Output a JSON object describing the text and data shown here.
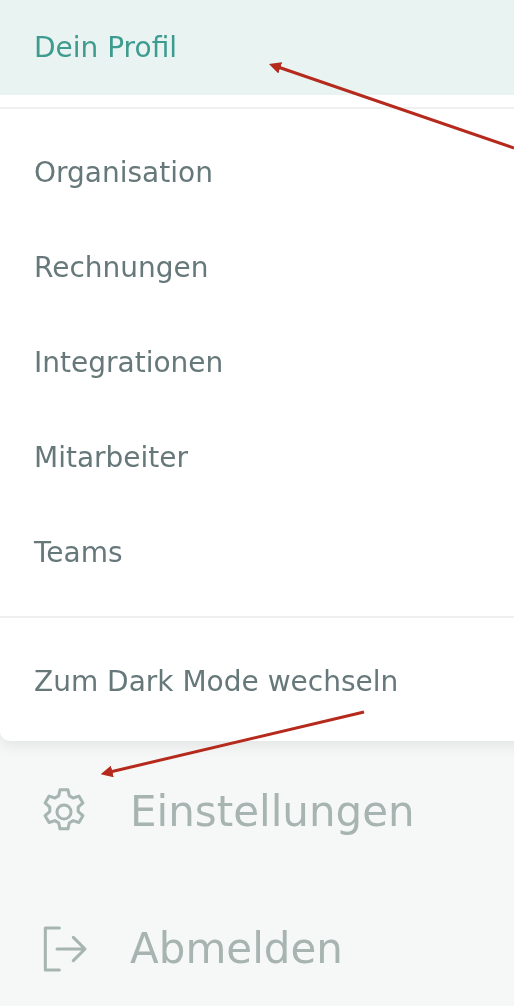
{
  "menu": {
    "sections": [
      [
        {
          "label": "Dein Profil",
          "selected": true
        }
      ],
      [
        {
          "label": "Organisation",
          "selected": false
        },
        {
          "label": "Rechnungen",
          "selected": false
        },
        {
          "label": "Integrationen",
          "selected": false
        },
        {
          "label": "Mitarbeiter",
          "selected": false
        },
        {
          "label": "Teams",
          "selected": false
        }
      ],
      [
        {
          "label": "Zum Dark Mode wechseln",
          "selected": false
        }
      ]
    ]
  },
  "sidebar": {
    "items": [
      {
        "kind": "settings",
        "label": "Einstellungen"
      },
      {
        "kind": "logout",
        "label": "Abmelden"
      }
    ]
  }
}
